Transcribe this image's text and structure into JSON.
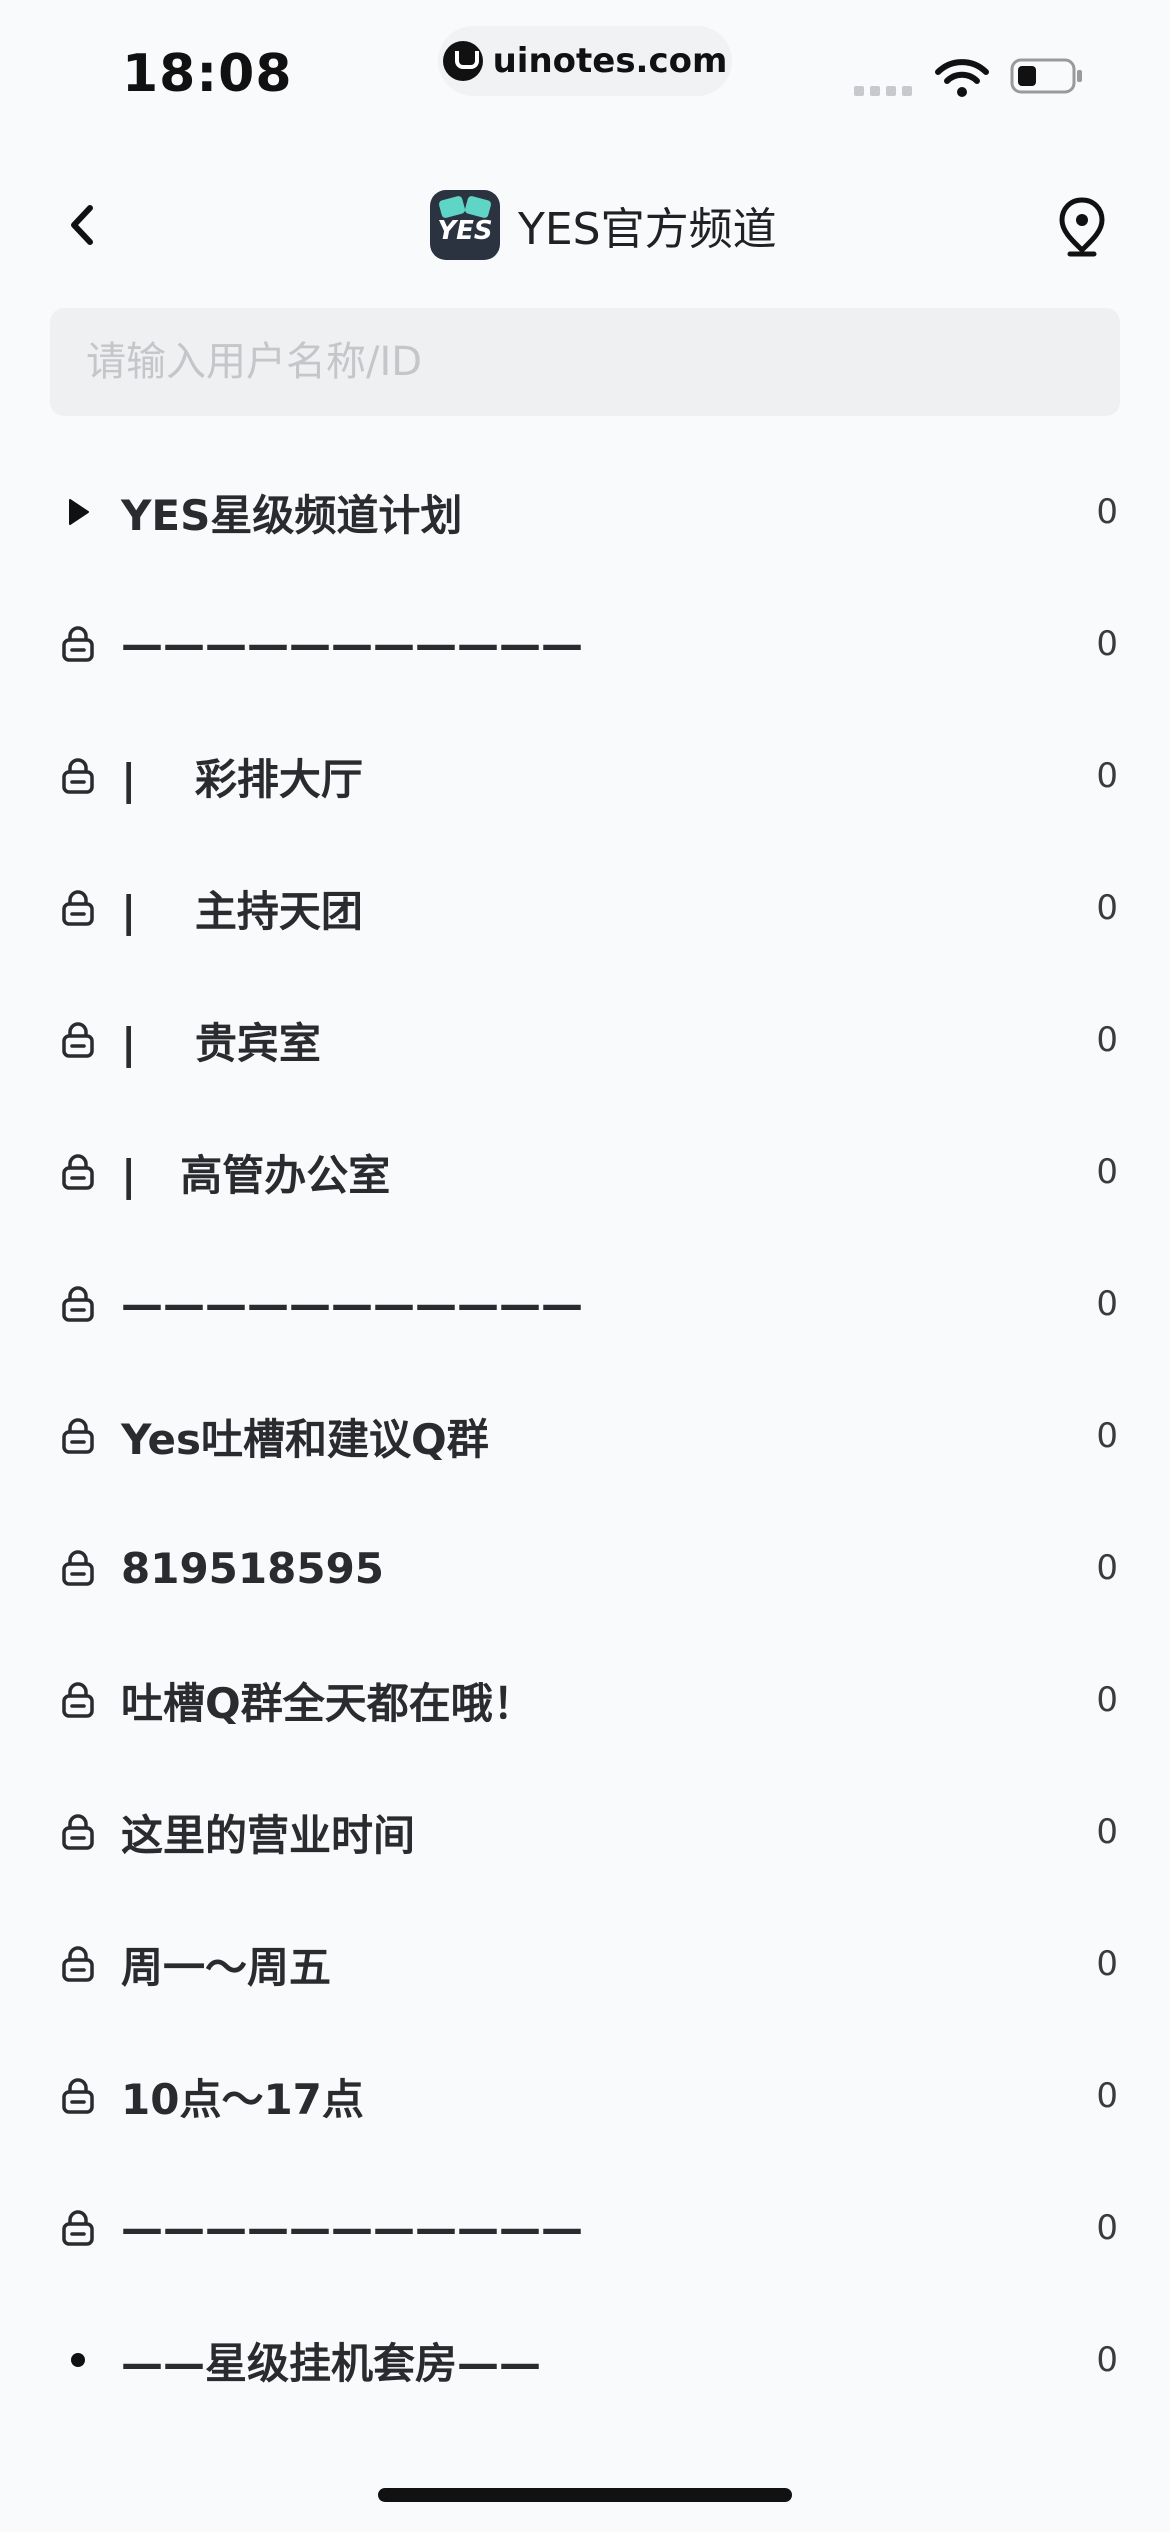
{
  "status_bar": {
    "time": "18:08",
    "url": "uinotes.com"
  },
  "nav": {
    "title": "YES官方频道",
    "logo_text": "YES"
  },
  "search": {
    "placeholder": "请输入用户名称/ID",
    "value": ""
  },
  "channels": [
    {
      "icon": "triangle-right-icon",
      "name": "YES星级频道计划",
      "count": "0"
    },
    {
      "icon": "lock-icon",
      "name": "———————————",
      "count": "0"
    },
    {
      "icon": "lock-icon",
      "name": "|    彩排大厅",
      "count": "0"
    },
    {
      "icon": "lock-icon",
      "name": "|    主持天团",
      "count": "0"
    },
    {
      "icon": "lock-icon",
      "name": "|    贵宾室",
      "count": "0"
    },
    {
      "icon": "lock-icon",
      "name": "|   高管办公室",
      "count": "0"
    },
    {
      "icon": "lock-icon",
      "name": "———————————",
      "count": "0"
    },
    {
      "icon": "lock-icon",
      "name": "Yes吐槽和建议Q群",
      "count": "0"
    },
    {
      "icon": "lock-icon",
      "name": "819518595",
      "count": "0"
    },
    {
      "icon": "lock-icon",
      "name": "吐槽Q群全天都在哦！",
      "count": "0"
    },
    {
      "icon": "lock-icon",
      "name": "这里的营业时间",
      "count": "0"
    },
    {
      "icon": "lock-icon",
      "name": "周一～周五",
      "count": "0"
    },
    {
      "icon": "lock-icon",
      "name": "10点～17点",
      "count": "0"
    },
    {
      "icon": "lock-icon",
      "name": "———————————",
      "count": "0"
    },
    {
      "icon": "dot-icon",
      "name": "——星级挂机套房——",
      "count": "0"
    }
  ],
  "colors": {
    "background": "#f9fafc",
    "search_bg": "#eff0f2",
    "text": "#2a2b2e",
    "logo_bg": "#2b3340",
    "logo_accent": "#5fd6c5"
  }
}
